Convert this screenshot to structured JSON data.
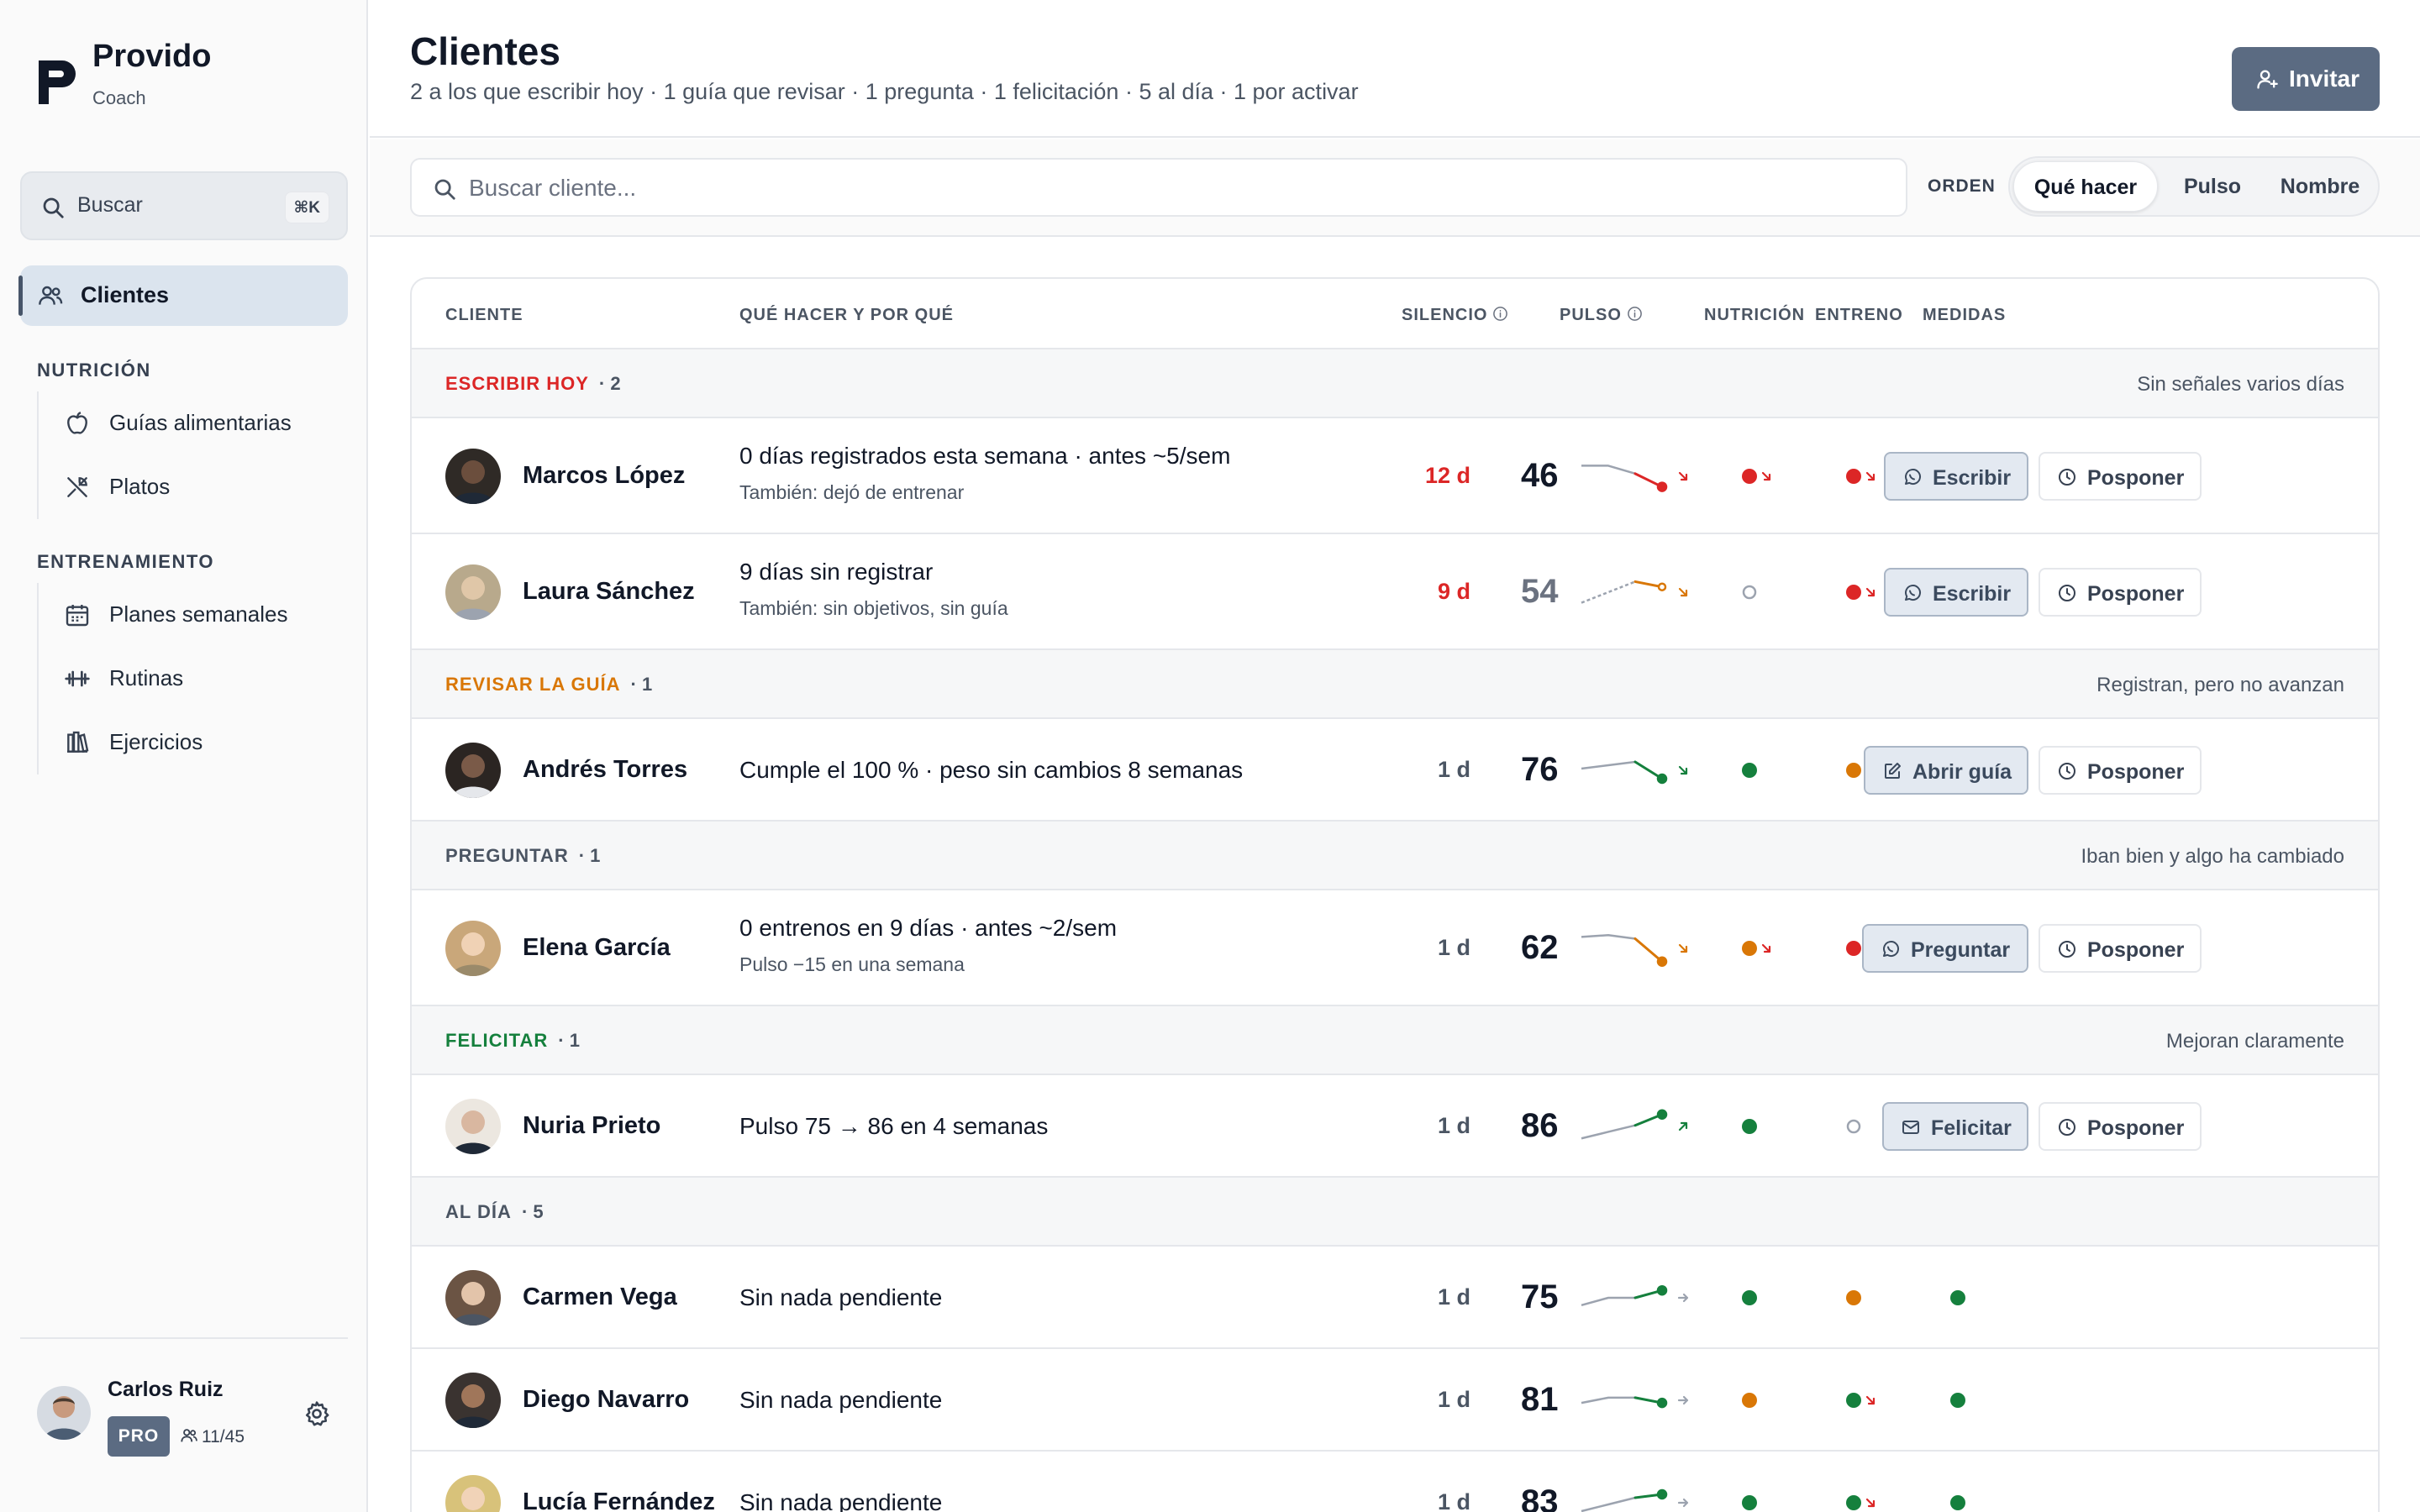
{
  "app": {
    "name": "Provido",
    "role": "Coach"
  },
  "sidebar": {
    "search": {
      "label": "Buscar",
      "shortcut": "⌘K"
    },
    "active_item": "Clientes",
    "sections": [
      {
        "title": "NUTRICIÓN",
        "items": [
          "Guías alimentarias",
          "Platos"
        ]
      },
      {
        "title": "ENTRENAMIENTO",
        "items": [
          "Planes semanales",
          "Rutinas",
          "Ejercicios"
        ]
      }
    ],
    "user": {
      "name": "Carlos Ruiz",
      "plan": "PRO",
      "clients": "11/45"
    }
  },
  "header": {
    "title": "Clientes",
    "subtitle": "2 a los que escribir hoy · 1 guía que revisar · 1 pregunta · 1 felicitación · 5 al día · 1 por activar",
    "invite_label": "Invitar"
  },
  "toolbar": {
    "search_placeholder": "Buscar cliente...",
    "order_label": "ORDEN",
    "sort_options": [
      "Qué hacer",
      "Pulso",
      "Nombre"
    ],
    "sort_active": "Qué hacer"
  },
  "table": {
    "columns": {
      "client": "CLIENTE",
      "todo": "QUÉ HACER Y POR QUÉ",
      "silence": "SILENCIO",
      "pulse": "PULSO",
      "nutrition": "NUTRICIÓN",
      "training": "ENTRENO",
      "measures": "MEDIDAS"
    },
    "secondary_action": "Posponer",
    "groups": [
      {
        "label": "ESCRIBIR HOY",
        "count": "· 2",
        "note": "Sin señales varios días",
        "color": "#dc2626"
      },
      {
        "label": "REVISAR LA GUÍA",
        "count": "· 1",
        "note": "Registran, pero no avanzan",
        "color": "#d97706"
      },
      {
        "label": "PREGUNTAR",
        "count": "· 1",
        "note": "Iban bien y algo ha cambiado",
        "color": "#4b5563"
      },
      {
        "label": "FELICITAR",
        "count": "· 1",
        "note": "Mejoran claramente",
        "color": "#15803d"
      },
      {
        "label": "AL DÍA",
        "count": "· 5",
        "note": "",
        "color": "#4b5563"
      }
    ],
    "rows": [
      {
        "name": "Marcos López",
        "reason": "0 días registrados esta semana · antes ~5/sem",
        "reason2": "También: dejó de entrenar",
        "silence": "12 d",
        "silence_alert": true,
        "pulse": "46",
        "pulse_muted": false,
        "trend": [
          54,
          54,
          51,
          46
        ],
        "trend_dir": "down",
        "trend_color": "#dc2626",
        "nutrition": {
          "c": "red",
          "a": "down"
        },
        "training": {
          "c": "red",
          "a": "down"
        },
        "measures": {
          "c": "green",
          "a": "down"
        },
        "action": "Escribir",
        "action_icon": "whatsapp"
      },
      {
        "name": "Laura Sánchez",
        "reason": "9 días sin registrar",
        "reason2": "También: sin objetivos, sin guía",
        "silence": "9 d",
        "silence_alert": true,
        "pulse": "54",
        "pulse_muted": true,
        "trend": [
          48,
          52,
          56,
          54
        ],
        "trend_dir": "down",
        "trend_color": "#d97706",
        "trend_dashed": true,
        "nutrition": {
          "c": "empty",
          "a": ""
        },
        "training": {
          "c": "red",
          "a": "down"
        },
        "measures": {
          "c": "green",
          "a": "down"
        },
        "action": "Escribir",
        "action_icon": "whatsapp"
      },
      {
        "name": "Andrés Torres",
        "reason": "Cumple el 100 % · peso sin cambios 8 semanas",
        "reason2": "",
        "silence": "1 d",
        "silence_alert": false,
        "pulse": "76",
        "pulse_muted": false,
        "trend": [
          79,
          80,
          81,
          76
        ],
        "trend_dir": "down",
        "trend_color": "#15803d",
        "nutrition": {
          "c": "green",
          "a": ""
        },
        "training": {
          "c": "orange",
          "a": "down"
        },
        "measures": {
          "c": "orange",
          "a": ""
        },
        "action": "Abrir guía",
        "action_icon": "edit"
      },
      {
        "name": "Elena García",
        "reason": "0 entrenos en 9 días · antes ~2/sem",
        "reason2": "Pulso −15 en una semana",
        "silence": "1 d",
        "silence_alert": false,
        "pulse": "62",
        "pulse_muted": false,
        "trend": [
          76,
          77,
          75,
          62
        ],
        "trend_dir": "down",
        "trend_color": "#d97706",
        "nutrition": {
          "c": "orange",
          "a": "down"
        },
        "training": {
          "c": "red",
          "a": "down"
        },
        "measures": {
          "c": "green",
          "a": ""
        },
        "action": "Preguntar",
        "action_icon": "whatsapp"
      },
      {
        "name": "Nuria Prieto",
        "reason": "Pulso 75 → 86 en 4 semanas",
        "reason2": "",
        "silence": "1 d",
        "silence_alert": false,
        "pulse": "86",
        "pulse_muted": false,
        "trend": [
          75,
          78,
          81,
          86
        ],
        "trend_dir": "up",
        "trend_color": "#15803d",
        "nutrition": {
          "c": "green",
          "a": ""
        },
        "training": {
          "c": "empty",
          "a": ""
        },
        "measures": {
          "c": "green",
          "a": ""
        },
        "action": "Felicitar",
        "action_icon": "mail"
      },
      {
        "name": "Carmen Vega",
        "reason": "Sin nada pendiente",
        "reason2": "",
        "silence": "1 d",
        "silence_alert": false,
        "pulse": "75",
        "pulse_muted": false,
        "trend": [
          72,
          74,
          74,
          76
        ],
        "trend_dir": "flat",
        "trend_color": "#15803d",
        "nutrition": {
          "c": "green",
          "a": ""
        },
        "training": {
          "c": "orange",
          "a": ""
        },
        "measures": {
          "c": "green",
          "a": ""
        },
        "action": "",
        "action_icon": ""
      },
      {
        "name": "Diego Navarro",
        "reason": "Sin nada pendiente",
        "reason2": "",
        "silence": "1 d",
        "silence_alert": false,
        "pulse": "81",
        "pulse_muted": false,
        "trend": [
          81,
          82,
          82,
          81
        ],
        "trend_dir": "flat",
        "trend_color": "#15803d",
        "nutrition": {
          "c": "orange",
          "a": ""
        },
        "training": {
          "c": "green",
          "a": "down"
        },
        "measures": {
          "c": "green",
          "a": ""
        },
        "action": "",
        "action_icon": ""
      },
      {
        "name": "Lucía Fernández",
        "reason": "Sin nada pendiente",
        "reason2": "",
        "silence": "1 d",
        "silence_alert": false,
        "pulse": "83",
        "pulse_muted": false,
        "trend": [
          78,
          80,
          82,
          83
        ],
        "trend_dir": "flat",
        "trend_color": "#15803d",
        "nutrition": {
          "c": "green",
          "a": ""
        },
        "training": {
          "c": "green",
          "a": "down"
        },
        "measures": {
          "c": "green",
          "a": ""
        },
        "action": "",
        "action_icon": ""
      }
    ]
  },
  "colors": {
    "red": "#dc2626",
    "orange": "#d97706",
    "green": "#15803d",
    "accent": "#5b6b82",
    "muted_pulse": "#6b7280"
  }
}
